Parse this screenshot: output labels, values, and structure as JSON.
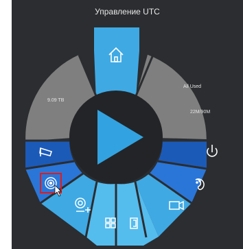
{
  "window": {
    "title": "Управление UTC"
  },
  "segments": [
    {
      "name": "home",
      "icon": "home-icon"
    },
    {
      "name": "left-storage",
      "value": "9.09 TB"
    },
    {
      "name": "right-storage",
      "line1": "All Used",
      "line2": "22M/90M"
    },
    {
      "name": "camera",
      "icon": "cctv-camera-icon"
    },
    {
      "name": "power",
      "icon": "power-icon"
    },
    {
      "name": "ptz-target",
      "icon": "target-icon",
      "selected": true
    },
    {
      "name": "palette",
      "icon": "palette-icon"
    },
    {
      "name": "ptz-add",
      "icon": "camera-plus-icon"
    },
    {
      "name": "layout-grid",
      "icon": "grid-icon"
    },
    {
      "name": "exit",
      "icon": "exit-door-icon"
    },
    {
      "name": "record",
      "icon": "video-camera-icon"
    }
  ],
  "center": {
    "icon": "play-icon"
  },
  "colors": {
    "background": "#2b2d30",
    "gray_segment": "#7f7f7f",
    "dark_blue": "#1c5ab8",
    "mid_blue": "#2a76d8",
    "light_blue": "#3fa9e4",
    "center_disc": "#232427",
    "play": "#32a3e0",
    "selection": "#e21b1b"
  }
}
